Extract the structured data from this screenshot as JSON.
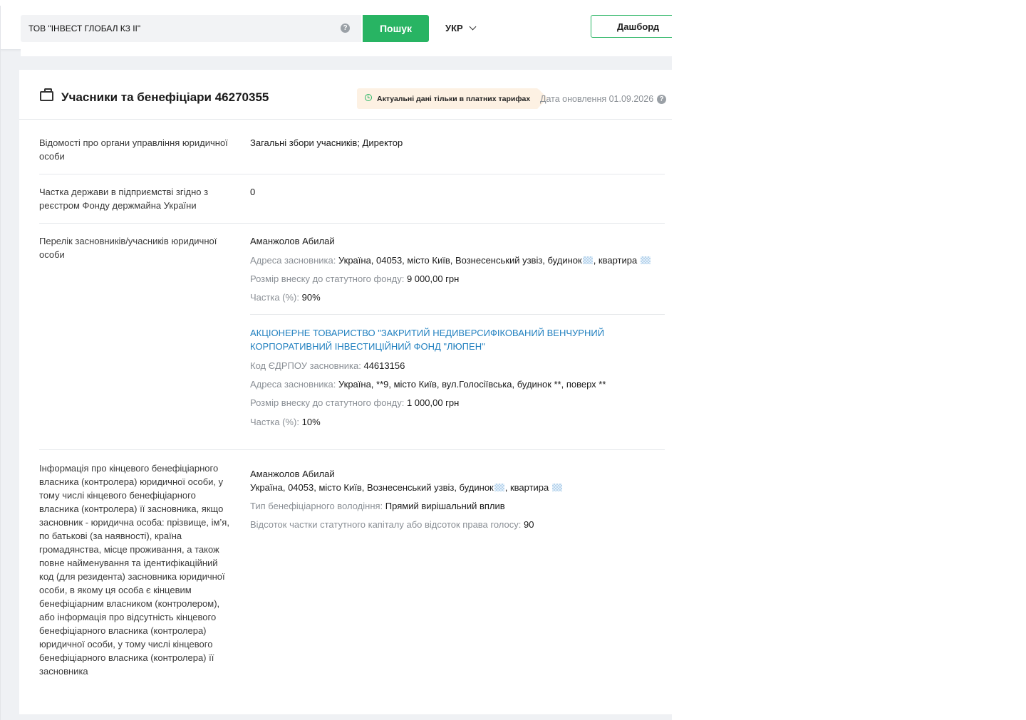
{
  "header": {
    "search_value": "ТОВ \"ІНВЕСТ ГЛОБАЛ КЗ ІІ\"",
    "search_button": "Пошук",
    "language": "УКР",
    "dashboard_button": "Дашборд"
  },
  "card": {
    "title": "Учасники та бенефіціари 46270355",
    "notice": "Актуальні дані тільки в платних тарифах",
    "update_date": "Дата оновлення 01.09.2026"
  },
  "rows": {
    "governance": {
      "label": "Відомості про органи управління юридичної особи",
      "value": "Загальні збори учасників; Директор"
    },
    "state_share": {
      "label": "Частка держави в підприємстві згідно з реєстром Фонду держмайна України",
      "value": "0"
    },
    "founders": {
      "label": "Перелік засновників/учасників юридичної особи",
      "items": [
        {
          "name": "Аманжолов Абилай",
          "address_key": "Адреса засновника:",
          "address_part1": "Україна, 04053, місто Київ, Вознесенський узвіз, будинок",
          "address_part2": ", квартира",
          "contribution_key": "Розмір внеску до статутного фонду:",
          "contribution_value": "9 000,00 грн",
          "share_key": "Частка (%):",
          "share_value": "90%"
        },
        {
          "name": "АКЦІОНЕРНЕ ТОВАРИСТВО \"ЗАКРИТИЙ НЕДИВЕРСИФІКОВАНИЙ ВЕНЧУРНИЙ КОРПОРАТИВНИЙ ІНВЕСТИЦІЙНИЙ ФОНД \"ЛЮПЕН\"",
          "code_key": "Код ЄДРПОУ засновника:",
          "code_value": "44613156",
          "address_key": "Адреса засновника:",
          "address_value": "Україна, **9, місто Київ, вул.Голосіївська, будинок **, поверх **",
          "contribution_key": "Розмір внеску до статутного фонду:",
          "contribution_value": "1 000,00 грн",
          "share_key": "Частка (%):",
          "share_value": "10%"
        }
      ]
    },
    "beneficiary": {
      "label": "Інформація про кінцевого бенефіціарного власника (контролера) юридичної особи, у тому числі кінцевого бенефіціарного власника (контролера) її засновника, якщо засновник - юридична особа: прізвище, ім’я, по батькові (за наявності), країна громадянства, місце проживання, а також повне найменування та ідентифікаційний код (для резидента) засновника юридичної особи, в якому ця особа є кінцевим бенефіціарним власником (контролером), або інформація про відсутність кінцевого бенефіціарного власника (контролера) юридичної особи, у тому числі кінцевого бенефіціарного власника (контролера) її засновника",
      "name": "Аманжолов Абилай",
      "address_part1": "Україна, 04053, місто Київ, Вознесенський узвіз, будинок",
      "address_part2": ", квартира",
      "type_key": "Тип бенефіціарного володіння:",
      "type_value": "Прямий вирішальний вплив",
      "percent_key": "Відсоток частки статутного капіталу або відсоток права голосу:",
      "percent_value": "90"
    }
  }
}
